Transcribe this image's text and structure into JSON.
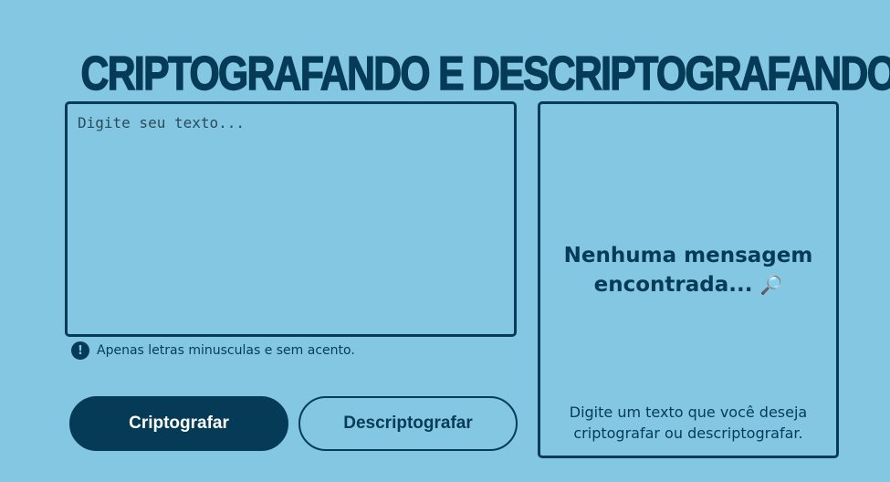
{
  "header": {
    "title": "CRIPTOGRAFANDO E DESCRIPTOGRAFANDO"
  },
  "input": {
    "placeholder": "Digite seu texto...",
    "value": ""
  },
  "hint": {
    "icon": "exclamation-icon",
    "icon_glyph": "!",
    "text": "Apenas letras minusculas e sem acento."
  },
  "buttons": {
    "encrypt_label": "Criptografar",
    "decrypt_label": "Descriptografar"
  },
  "output": {
    "title_line1": "Nenhuma mensagem",
    "title_line2": "encontrada...",
    "icon": "magnifier-icon",
    "icon_glyph": "🔎",
    "subtitle_line1": "Digite um texto que você deseja",
    "subtitle_line2": "criptografar ou descriptografar."
  },
  "colors": {
    "background": "#84C7E2",
    "primary": "#053B56",
    "button_text": "#FFFFFF"
  }
}
